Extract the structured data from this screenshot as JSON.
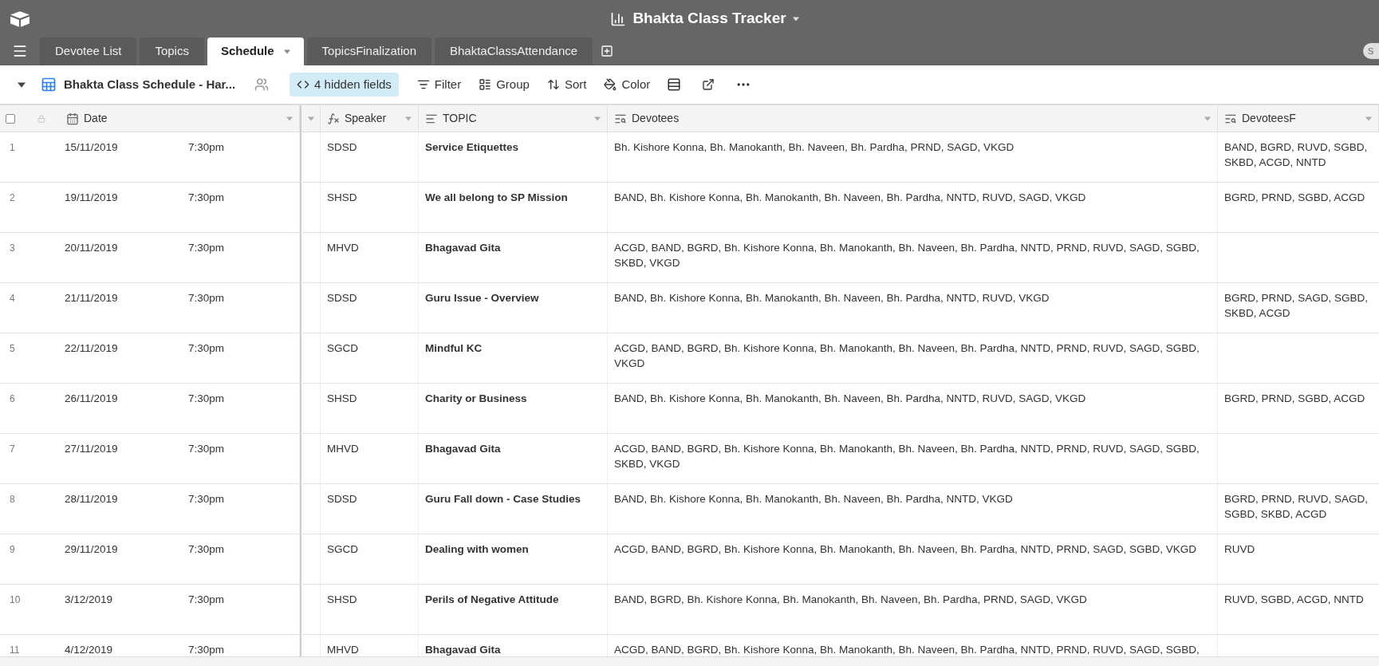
{
  "app": {
    "title": "Bhakta Class Tracker",
    "share_label": "S"
  },
  "tabs": [
    {
      "label": "Devotee List",
      "selected": false
    },
    {
      "label": "Topics",
      "selected": false
    },
    {
      "label": "Schedule",
      "selected": true
    },
    {
      "label": "TopicsFinalization",
      "selected": false
    },
    {
      "label": "BhaktaClassAttendance",
      "selected": false
    }
  ],
  "view": {
    "name": "Bhakta Class Schedule - Har...",
    "tools": [
      {
        "kind": "hidden_fields",
        "label": "4 hidden fields",
        "highlighted": true
      },
      {
        "kind": "filter",
        "label": "Filter",
        "highlighted": false
      },
      {
        "kind": "group",
        "label": "Group",
        "highlighted": false
      },
      {
        "kind": "sort",
        "label": "Sort",
        "highlighted": false
      },
      {
        "kind": "color",
        "label": "Color",
        "highlighted": false
      }
    ]
  },
  "table": {
    "all_selected": false,
    "columns": [
      {
        "name": "Date",
        "kind": "date"
      },
      {
        "name": "Speaker",
        "kind": "formula"
      },
      {
        "name": "TOPIC",
        "kind": "rich_text"
      },
      {
        "name": "Devotees",
        "kind": "lookup"
      },
      {
        "name": "DevoteesF",
        "kind": "lookup"
      }
    ],
    "rows": [
      {
        "number": "1",
        "date": "15/11/2019",
        "time": "7:30pm",
        "speaker": "SDSD",
        "topic": "Service Etiquettes",
        "devotees": "Bh. Kishore Konna, Bh. Manokanth, Bh. Naveen, Bh. Pardha, PRND, SAGD, VKGD",
        "devotees_f": "BAND, BGRD, RUVD, SGBD, SKBD, ACGD, NNTD"
      },
      {
        "number": "2",
        "date": "19/11/2019",
        "time": "7:30pm",
        "speaker": "SHSD",
        "topic": "We all belong to SP Mission",
        "devotees": "BAND, Bh. Kishore Konna, Bh. Manokanth, Bh. Naveen, Bh. Pardha, NNTD, RUVD, SAGD, VKGD",
        "devotees_f": "BGRD, PRND, SGBD, ACGD"
      },
      {
        "number": "3",
        "date": "20/11/2019",
        "time": "7:30pm",
        "speaker": "MHVD",
        "topic": "Bhagavad Gita",
        "devotees": "ACGD, BAND, BGRD, Bh. Kishore Konna, Bh. Manokanth, Bh. Naveen, Bh. Pardha, NNTD, PRND, RUVD, SAGD, SGBD, SKBD, VKGD"
      },
      {
        "number": "4",
        "date": "21/11/2019",
        "time": "7:30pm",
        "speaker": "SDSD",
        "topic": "Guru Issue - Overview",
        "devotees": "BAND, Bh. Kishore Konna, Bh. Manokanth, Bh. Naveen, Bh. Pardha, NNTD, RUVD, VKGD",
        "devotees_f": "BGRD, PRND, SAGD, SGBD, SKBD, ACGD"
      },
      {
        "number": "5",
        "date": "22/11/2019",
        "time": "7:30pm",
        "speaker": "SGCD",
        "topic": "Mindful KC",
        "devotees": "ACGD, BAND, BGRD, Bh. Kishore Konna, Bh. Manokanth, Bh. Naveen, Bh. Pardha, NNTD, PRND, RUVD, SAGD, SGBD, VKGD"
      },
      {
        "number": "6",
        "date": "26/11/2019",
        "time": "7:30pm",
        "speaker": "SHSD",
        "topic": "Charity or Business",
        "devotees": "BAND, Bh. Kishore Konna, Bh. Manokanth, Bh. Naveen, Bh. Pardha, NNTD, RUVD, SAGD, VKGD",
        "devotees_f": "BGRD, PRND, SGBD, ACGD"
      },
      {
        "number": "7",
        "date": "27/11/2019",
        "time": "7:30pm",
        "speaker": "MHVD",
        "topic": "Bhagavad Gita",
        "devotees": "ACGD, BAND, BGRD, Bh. Kishore Konna, Bh. Manokanth, Bh. Naveen, Bh. Pardha, NNTD, PRND, RUVD, SAGD, SGBD, SKBD, VKGD"
      },
      {
        "number": "8",
        "date": "28/11/2019",
        "time": "7:30pm",
        "speaker": "SDSD",
        "topic": "Guru Fall down - Case Studies",
        "devotees": "BAND, Bh. Kishore Konna, Bh. Manokanth, Bh. Naveen, Bh. Pardha, NNTD, VKGD",
        "devotees_f": "BGRD, PRND, RUVD, SAGD, SGBD, SKBD, ACGD"
      },
      {
        "number": "9",
        "date": "29/11/2019",
        "time": "7:30pm",
        "speaker": "SGCD",
        "topic": "Dealing with women",
        "devotees": "ACGD, BAND, BGRD, Bh. Kishore Konna, Bh. Manokanth, Bh. Naveen, Bh. Pardha, NNTD, PRND, SAGD, SGBD, VKGD",
        "devotees_f": "RUVD"
      },
      {
        "number": "10",
        "date": "3/12/2019",
        "time": "7:30pm",
        "speaker": "SHSD",
        "topic": "Perils of Negative Attitude",
        "devotees": "BAND, BGRD, Bh. Kishore Konna, Bh. Manokanth, Bh. Naveen, Bh. Pardha, PRND, SAGD, VKGD",
        "devotees_f": "RUVD, SGBD, ACGD, NNTD"
      },
      {
        "number": "11",
        "date": "4/12/2019",
        "time": "7:30pm",
        "speaker": "MHVD",
        "topic": "Bhagavad Gita",
        "devotees": "ACGD, BAND, BGRD, Bh. Kishore Konna, Bh. Manokanth, Bh. Naveen, Bh. Pardha, NNTD, PRND, RUVD, SAGD, SGBD,"
      }
    ]
  }
}
